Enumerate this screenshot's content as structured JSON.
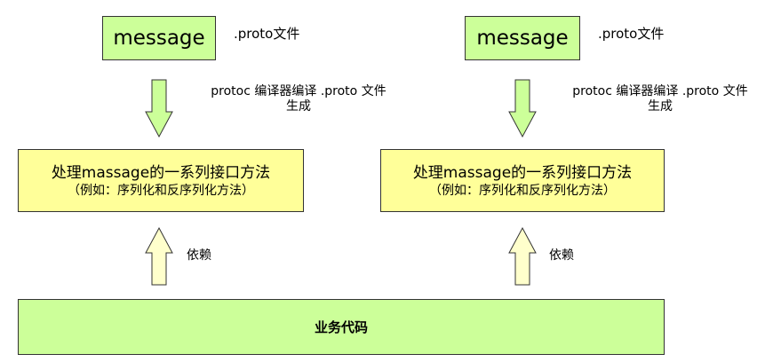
{
  "colors": {
    "message_box": "#ccff99",
    "api_box": "#ffff99",
    "business_box": "#ccff99",
    "down_arrow": "#ccff99",
    "up_arrow": "#ffffcc",
    "border": "#333333"
  },
  "left": {
    "message_label": "message",
    "proto_file_label": ".proto文件",
    "compile_label_line1": "protoc 编译器编译 .proto 文件",
    "compile_label_line2": "生成",
    "api_title": "处理massage的一系列接口方法",
    "api_subtitle": "（例如：序列化和反序列化方法）",
    "depend_label": "依赖"
  },
  "right": {
    "message_label": "message",
    "proto_file_label": ".proto文件",
    "compile_label_line1": "protoc 编译器编译 .proto 文件",
    "compile_label_line2": "生成",
    "api_title": "处理massage的一系列接口方法",
    "api_subtitle": "（例如：序列化和反序列化方法）",
    "depend_label": "依赖"
  },
  "business_code_label": "业务代码"
}
